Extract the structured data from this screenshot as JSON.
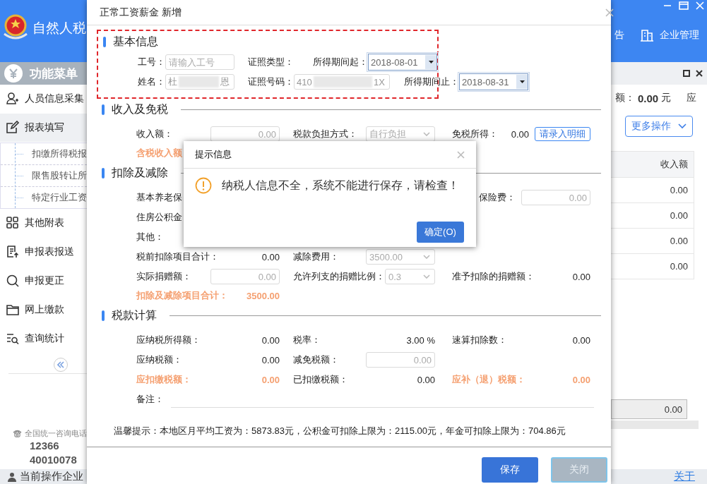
{
  "app": {
    "title": "自然人税",
    "header_links": [
      {
        "label": "告"
      },
      {
        "label": "企业管理"
      }
    ],
    "menu_title": "功能菜单",
    "menu": [
      {
        "label": "人员信息采集",
        "selected": false
      },
      {
        "label": "报表填写",
        "selected": true,
        "children": [
          {
            "label": "扣缴所得税报"
          },
          {
            "label": "限售股转让所"
          },
          {
            "label": "特定行业工资"
          }
        ]
      },
      {
        "label": "其他附表",
        "selected": false
      },
      {
        "label": "申报表报送",
        "selected": false
      },
      {
        "label": "申报更正",
        "selected": false
      },
      {
        "label": "网上缴款",
        "selected": false
      },
      {
        "label": "查询统计",
        "selected": false
      }
    ],
    "hotline": {
      "label": "全国统一咨询电话",
      "numbers": [
        "12366",
        "40010078"
      ]
    },
    "summary": {
      "label": "额：",
      "amount": "0.00",
      "unit": "元",
      "next_label": "应"
    },
    "more_button": "更多操作",
    "table": {
      "columns": [
        "收入额"
      ],
      "rows": [
        [
          "0.00"
        ],
        [
          "0.00"
        ],
        [
          "0.00"
        ],
        [
          "0.00"
        ]
      ],
      "footer": [
        "0.00"
      ]
    },
    "status_bar": {
      "label": "当前操作企业",
      "link": "关于"
    }
  },
  "dialog": {
    "title": "正常工资薪金 新增",
    "sections": [
      {
        "title": "基本信息",
        "marked": true,
        "rows": [
          [
            {
              "label": "工号：",
              "kind": "input",
              "placeholder": "请输入工号"
            },
            {
              "label": "证照类型："
            },
            {
              "label": "所得期间起：",
              "kind": "date",
              "value": "2018-08-01"
            }
          ],
          [
            {
              "label": "姓名：",
              "kind": "redacted",
              "value_parts": [
                "杜",
                "恩"
              ]
            },
            {
              "label": "证照号码：",
              "kind": "redacted",
              "value_parts": [
                "410",
                "1X"
              ]
            },
            {
              "label": "所得期间止：",
              "kind": "date",
              "value": "2018-08-31"
            }
          ]
        ]
      },
      {
        "title": "收入及免税",
        "marked": false,
        "rows": [
          [
            {
              "label": "收入额：",
              "kind": "input",
              "value": "0.00"
            },
            {
              "label": "税款负担方式：",
              "kind": "select",
              "value": "自行负担"
            },
            {
              "label": "免税所得：",
              "kind": "text",
              "value": "0.00",
              "button": "请录入明细"
            }
          ],
          [
            {
              "label": "含税收入额",
              "highlight": true
            }
          ]
        ]
      },
      {
        "title": "扣除及减除",
        "marked": false,
        "rows": [
          [
            {
              "label": "基本养老保"
            },
            {},
            {
              "label": "保险费：",
              "kind": "input",
              "value": "0.00"
            }
          ],
          [
            {
              "label": "住房公积金"
            }
          ],
          [
            {
              "label": "其他："
            }
          ],
          [
            {
              "label": "税前扣除项目合计：",
              "kind": "text",
              "value": "0.00"
            },
            {
              "label": "减除费用：",
              "kind": "select",
              "value": "3500.00"
            }
          ],
          [
            {
              "label": "实际捐赠额：",
              "kind": "input",
              "value": "0.00"
            },
            {
              "label": "允许列支的捐赠比例：",
              "kind": "select",
              "value": "0.3"
            },
            {
              "label": "准予扣除的捐赠额：",
              "kind": "text",
              "value": "0.00"
            }
          ],
          [
            {
              "label": "扣除及减除项目合计：",
              "kind": "text",
              "value": "3500.00",
              "highlight": true
            }
          ]
        ]
      },
      {
        "title": "税款计算",
        "marked": false,
        "rows": [
          [
            {
              "label": "应纳税所得额：",
              "kind": "text",
              "value": "0.00"
            },
            {
              "label": "税率：",
              "kind": "text",
              "value": "3.00 %"
            },
            {
              "label": "速算扣除数：",
              "kind": "text",
              "value": "0.00"
            }
          ],
          [
            {
              "label": "应纳税额：",
              "kind": "text",
              "value": "0.00"
            },
            {
              "label": "减免税额：",
              "kind": "input",
              "value": "0.00"
            }
          ],
          [
            {
              "label": "应扣缴税额：",
              "kind": "text",
              "value": "0.00",
              "highlight": true
            },
            {
              "label": "已扣缴税额：",
              "kind": "text",
              "value": "0.00"
            },
            {
              "label": "应补（退）税额：",
              "kind": "text",
              "value": "0.00",
              "highlight": true
            }
          ],
          [
            {
              "label": "备注：",
              "kind": "line"
            }
          ]
        ]
      }
    ],
    "tip": "温馨提示：本地区月平均工资为：5873.83元，公积金可扣除上限为：2115.00元，年金可扣除上限为：704.86元",
    "buttons": [
      {
        "label": "保存",
        "kind": "primary"
      },
      {
        "label": "关闭",
        "kind": "secondary"
      }
    ]
  },
  "alert": {
    "title": "提示信息",
    "message": "纳税人信息不全，系统不能进行保存，请检查！",
    "button": "确定(O)"
  }
}
